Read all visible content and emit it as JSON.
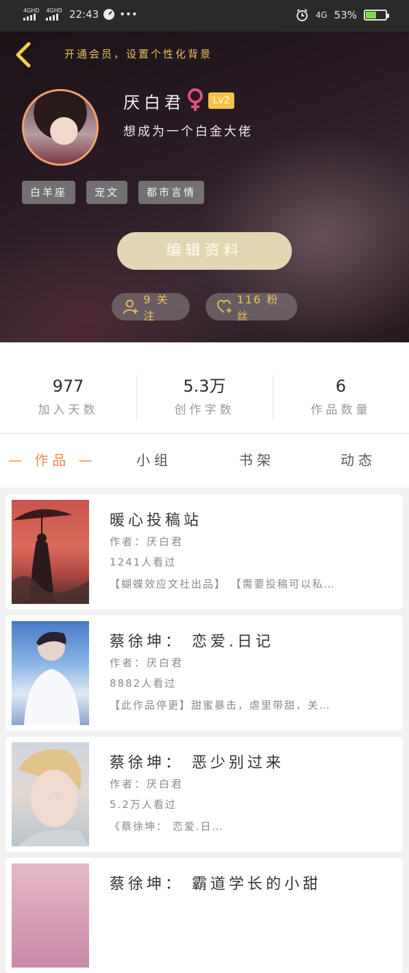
{
  "status_bar": {
    "signal1": "4GHD",
    "signal2": "4GHD",
    "time": "22:43",
    "more": "•••",
    "network": "4G",
    "battery": "53%",
    "battery_level": 0.53
  },
  "header": {
    "vip_text": "开通会员，设置个性化背景"
  },
  "profile": {
    "name": "厌白君",
    "level": "Lv2",
    "signature": "想成为一个白金大佬",
    "tags": [
      "白羊座",
      "宠文",
      "都市言情"
    ],
    "edit_button": "编辑资料",
    "follow_label": "9 关注",
    "fans_label": "116 粉丝"
  },
  "stats": [
    {
      "value": "977",
      "label": "加入天数"
    },
    {
      "value": "5.3万",
      "label": "创作字数"
    },
    {
      "value": "6",
      "label": "作品数量"
    }
  ],
  "tabs": {
    "active": "— 作品 —",
    "group": "小组",
    "bookshelf": "书架",
    "activity": "动态"
  },
  "works": [
    {
      "title": "暖心投稿站",
      "author": "作者：厌白君",
      "views": "1241人看过",
      "desc": "【蝴蝶效应文社出品】 【需要投稿可以私…"
    },
    {
      "title": "蔡徐坤：  恋爱.日记",
      "author": "作者：厌白君",
      "views": "8882人看过",
      "desc": "【此作品停更】甜蜜暴击，虐里带甜，关…"
    },
    {
      "title": "蔡徐坤：  恶少别过来",
      "author": "作者：厌白君",
      "views": "5.2万人看过",
      "desc": "《蔡徐坤：  恋爱.日…"
    },
    {
      "title": "蔡徐坤：  霸道学长的小甜",
      "author": "",
      "views": "",
      "desc": ""
    }
  ],
  "colors": {
    "accent": "#f08a4b",
    "gold": "#e7c25a",
    "button": "#e3d6b4",
    "level_badge": "#f5c24a",
    "gender": "#e1507a"
  }
}
